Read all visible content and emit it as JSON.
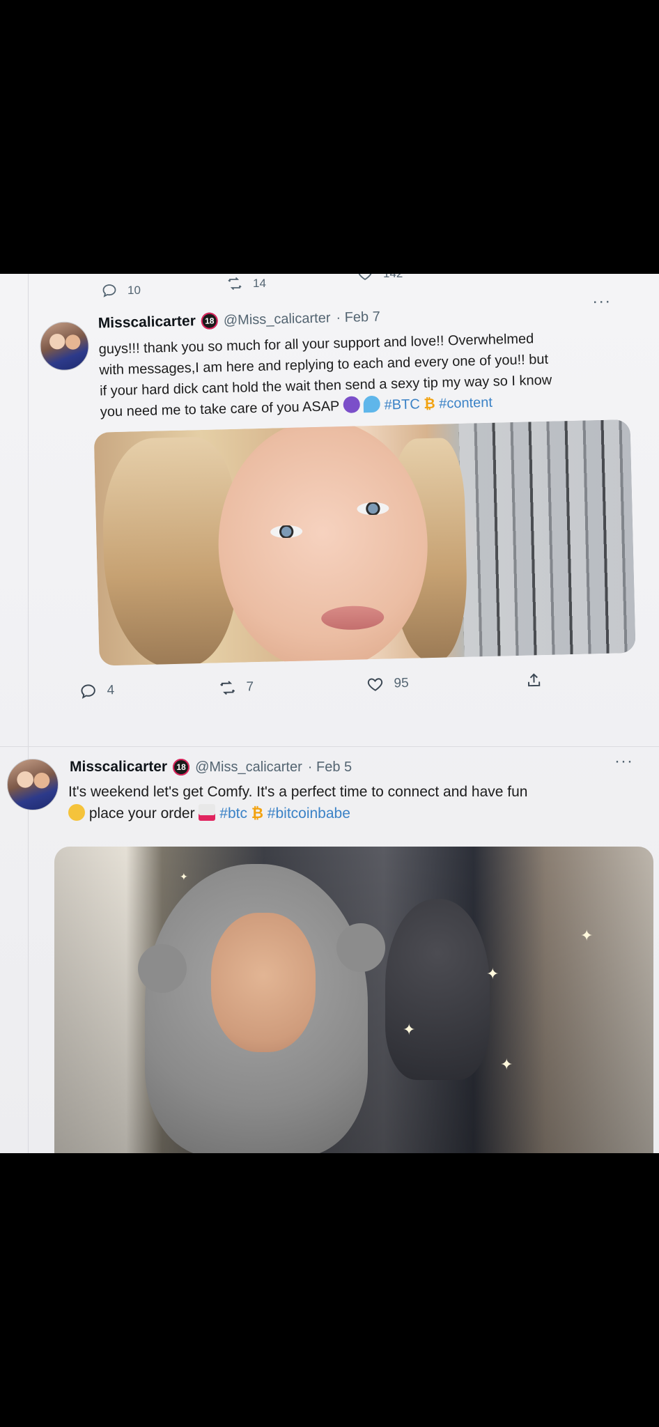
{
  "top_actions": {
    "replies": "10",
    "retweets": "14",
    "likes": "142"
  },
  "tweet1": {
    "name": "Misscalicarter",
    "badge": "18",
    "handle": "@Miss_calicarter",
    "date": "· Feb 7",
    "more": "···",
    "text_line1": "guys!!! thank you so much for all your support and love!! Overwhelmed",
    "text_line2": "with messages,I am here and replying to each and every one of you!! but",
    "text_line3": "if your hard dick cant hold the wait then send a sexy tip my way so I know",
    "text_line4": "you need me to take care of you ASAP",
    "hashtag1": "#BTC",
    "btc_symbol": "₿",
    "hashtag2": "#content",
    "replies": "4",
    "retweets": "7",
    "likes": "95"
  },
  "tweet2": {
    "name": "Misscalicarter",
    "badge": "18",
    "handle": "@Miss_calicarter",
    "date": "· Feb 5",
    "more": "···",
    "text_line1": "It's weekend let's get Comfy. It's a perfect time to connect and have fun",
    "text_line2": "place your order",
    "hashtag1": "#btc",
    "btc_symbol": "₿",
    "hashtag2": "#bitcoinbabe"
  },
  "icons": {
    "reply": "reply-icon",
    "retweet": "retweet-icon",
    "like": "heart-icon",
    "share": "share-icon",
    "more": "more-icon"
  },
  "colors": {
    "hashtag": "#3b82c6",
    "btc": "#f2a20f",
    "meta": "#536471"
  }
}
